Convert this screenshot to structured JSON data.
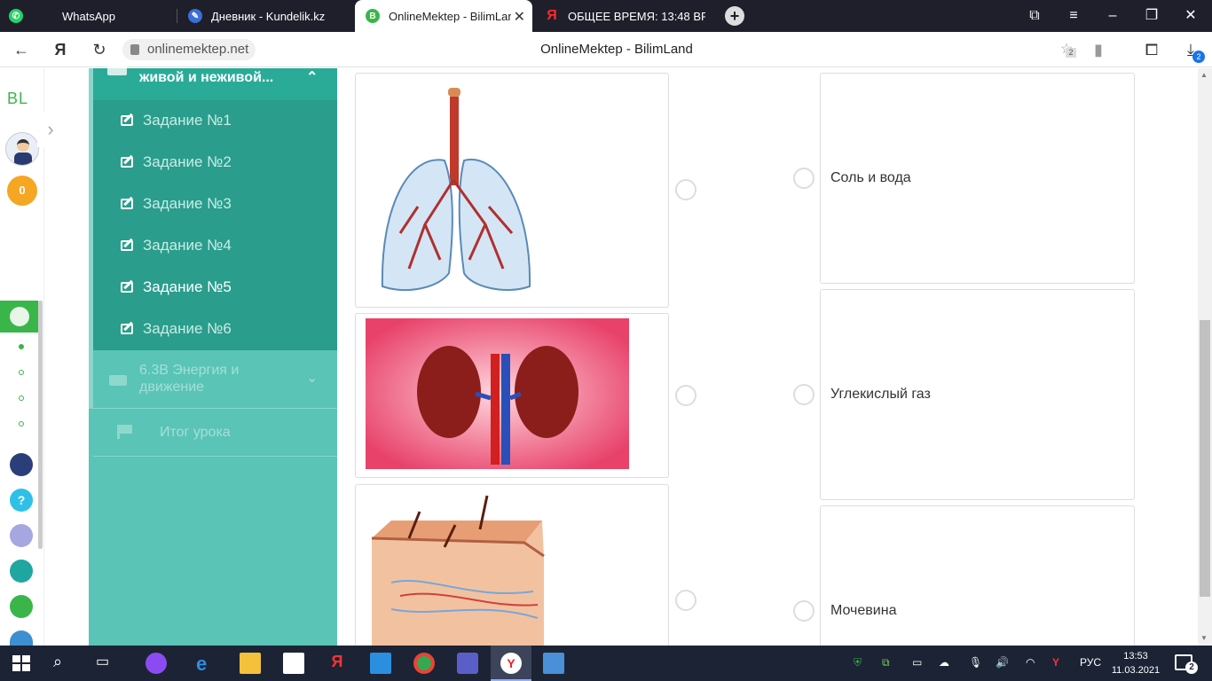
{
  "browser": {
    "tabs": [
      {
        "label": "WhatsApp",
        "active": false
      },
      {
        "label": "Дневник - Kundelik.kz",
        "active": false
      },
      {
        "label": "OnlineMektep - BilimLar",
        "active": true
      },
      {
        "label": "ОБЩЕЕ ВРЕМЯ: 13:48 ВРЕ",
        "active": false
      }
    ],
    "url": "onlinemektep.net",
    "page_title": "OnlineMektep - BilimLand",
    "downloads_count": "2",
    "collections_count": "2"
  },
  "rail": {
    "logo": "BL",
    "coins": "0"
  },
  "lesson": {
    "current_section": "живой и неживой...",
    "tasks": [
      {
        "label": "Задание №1"
      },
      {
        "label": "Задание №2"
      },
      {
        "label": "Задание №3"
      },
      {
        "label": "Задание №4"
      },
      {
        "label": "Задание №5"
      },
      {
        "label": "Задание №6"
      }
    ],
    "next_section": "6.3В Энергия и движение",
    "summary": "Итог урока"
  },
  "exercise": {
    "answers": [
      {
        "label": "Соль и вода"
      },
      {
        "label": "Углекислый газ"
      },
      {
        "label": "Мочевина"
      }
    ]
  },
  "taskbar": {
    "language": "РУС",
    "time": "13:53",
    "date": "11.03.2021",
    "notifications": "2"
  }
}
